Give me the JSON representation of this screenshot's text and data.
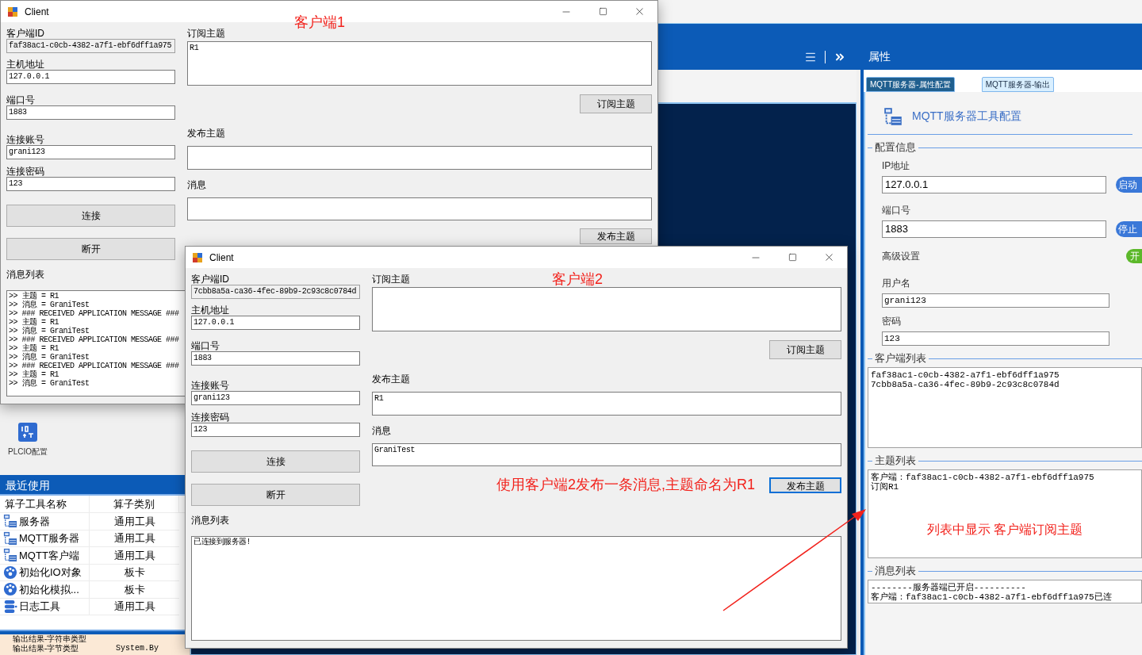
{
  "background": {
    "sidebar": {
      "tile": {
        "label": "PLCIO配置"
      },
      "recent_title": "最近使用",
      "table": {
        "columns": [
          "算子工具名称",
          "算子类别"
        ],
        "rows": [
          {
            "kind": "server",
            "name": "服务器",
            "category": "通用工具"
          },
          {
            "kind": "server",
            "name": "MQTT服务器",
            "category": "通用工具"
          },
          {
            "kind": "server",
            "name": "MQTT客户端",
            "category": "通用工具"
          },
          {
            "kind": "board",
            "name": "初始化IO对象",
            "category": "板卡"
          },
          {
            "kind": "board",
            "name": "初始化模拟...",
            "category": "板卡"
          },
          {
            "kind": "log",
            "name": "日志工具",
            "category": "通用工具"
          }
        ]
      },
      "output_rows": [
        {
          "name": "输出结果-字符串类型"
        },
        {
          "name": "输出结果-字节类型",
          "type": "System.By"
        }
      ]
    },
    "properties": {
      "title": "属性",
      "tabs": [
        {
          "label": "MQTT服务器-属性配置",
          "selected": true
        },
        {
          "label": "MQTT服务器-输出",
          "selected": false
        }
      ],
      "heading": "MQTT服务器工具配置",
      "config_group": "配置信息",
      "ip": {
        "label": "IP地址",
        "value": "127.0.0.1",
        "button": "启动"
      },
      "port": {
        "label": "端口号",
        "value": "1883",
        "button": "停止"
      },
      "advanced": {
        "label": "高级设置",
        "toggle": "开",
        "on": true
      },
      "username": {
        "label": "用户名",
        "value": "grani123"
      },
      "password": {
        "label": "密码",
        "value": "123"
      },
      "client_list": {
        "title": "客户端列表",
        "lines": [
          "faf38ac1-c0cb-4382-a7f1-ebf6dff1a975",
          "7cbb8a5a-ca36-4fec-89b9-2c93c8c0784d"
        ]
      },
      "topic_list": {
        "title": "主题列表",
        "lines": [
          "客户端：faf38ac1-c0cb-4382-a7f1-ebf6dff1a975",
          "订阅R1"
        ],
        "note": "列表中显示 客户端订阅主题"
      },
      "message_list": {
        "title": "消息列表",
        "lines": [
          "--------服务器端已开启----------",
          "客户端：faf38ac1-c0cb-4382-a7f1-ebf6dff1a975已连"
        ]
      }
    }
  },
  "clients": [
    {
      "title": "Client",
      "annotation": "客户端1",
      "fields": [
        {
          "label": "客户端ID",
          "value": "faf38ac1-c0cb-4382-a7f1-ebf6dff1a975",
          "readonly": true
        },
        {
          "label": "主机地址",
          "value": "127.0.0.1",
          "readonly": false
        },
        {
          "label": "端口号",
          "value": "1883",
          "readonly": false
        },
        {
          "label": "连接账号",
          "value": "grani123",
          "readonly": false
        },
        {
          "label": "连接密码",
          "value": "123",
          "readonly": false
        }
      ],
      "connect_button": "连接",
      "disconnect_button": "断开",
      "subscribe": {
        "label": "订阅主题",
        "value": "R1",
        "button": "订阅主题"
      },
      "publish": {
        "label": "发布主题"
      },
      "message": {
        "label": "消息"
      },
      "publish_button": {
        "label": "发布主题",
        "focused": false
      },
      "messages": {
        "label": "消息列表",
        "lines": [
          ">> 主题 = R1",
          ">> 消息 = GraniTest",
          ">> ### RECEIVED APPLICATION MESSAGE ###",
          ">> 主题 = R1",
          ">> 消息 = GraniTest",
          ">> ### RECEIVED APPLICATION MESSAGE ###",
          ">> 主题 = R1",
          ">> 消息 = GraniTest",
          ">> ### RECEIVED APPLICATION MESSAGE ###",
          ">> 主题 = R1",
          ">> 消息 = GraniTest"
        ]
      }
    },
    {
      "title": "Client",
      "annotation": "客户端2",
      "fields": [
        {
          "label": "客户端ID",
          "value": "7cbb8a5a-ca36-4fec-89b9-2c93c8c0784d",
          "readonly": true
        },
        {
          "label": "主机地址",
          "value": "127.0.0.1",
          "readonly": false
        },
        {
          "label": "端口号",
          "value": "1883",
          "readonly": false
        },
        {
          "label": "连接账号",
          "value": "grani123",
          "readonly": false
        },
        {
          "label": "连接密码",
          "value": "123",
          "readonly": false
        }
      ],
      "connect_button": "连接",
      "disconnect_button": "断开",
      "subscribe": {
        "label": "订阅主题",
        "button": "订阅主题"
      },
      "publish": {
        "label": "发布主题",
        "value": "R1"
      },
      "message": {
        "label": "消息",
        "value": "GraniTest"
      },
      "publish_button": {
        "label": "发布主题",
        "focused": true,
        "note": "使用客户端2发布一条消息,主题命名为R1"
      },
      "messages": {
        "label": "消息列表",
        "lines": [
          "已连接到服务器!"
        ]
      }
    }
  ]
}
